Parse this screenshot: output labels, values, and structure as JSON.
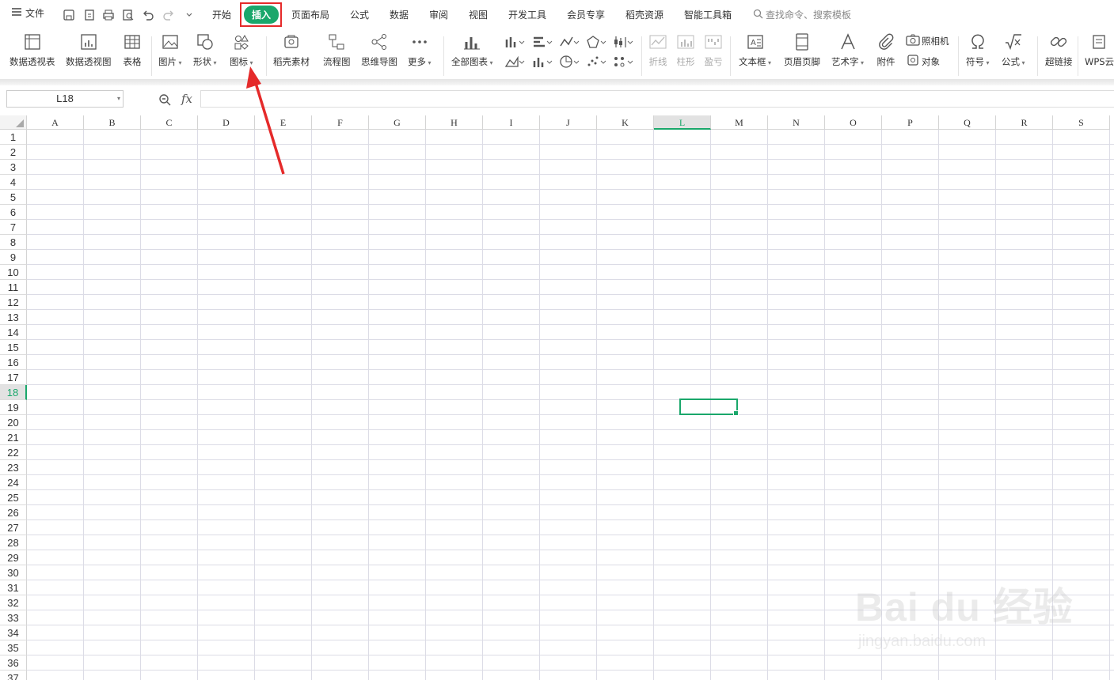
{
  "topbar": {
    "file_menu": "文件",
    "tabs": [
      "开始",
      "插入",
      "页面布局",
      "公式",
      "数据",
      "审阅",
      "视图",
      "开发工具",
      "会员专享",
      "稻壳资源",
      "智能工具箱"
    ],
    "search_placeholder": "查找命令、搜索模板",
    "accent": "#1aa76b"
  },
  "ribbon": {
    "groups": [
      [
        "数据透视表",
        "数据透视图",
        "表格"
      ],
      [
        "图片",
        "形状",
        "图标",
        "稻壳素材",
        "流程图",
        "思维导图",
        "更多"
      ],
      [
        "全部图表"
      ],
      [
        "折线",
        "柱形",
        "盈亏"
      ],
      [
        "文本框",
        "页眉页脚",
        "艺术字",
        "附件",
        "照相机",
        "对象"
      ],
      [
        "符号",
        "公式"
      ],
      [
        "超链接",
        "WPS云"
      ]
    ]
  },
  "formula_bar": {
    "name_box": "L18",
    "fx": "fx",
    "value": ""
  },
  "grid": {
    "columns": [
      "A",
      "B",
      "C",
      "D",
      "E",
      "F",
      "G",
      "H",
      "I",
      "J",
      "K",
      "L",
      "M",
      "N",
      "O",
      "P",
      "Q",
      "R",
      "S"
    ],
    "rows": [
      "1",
      "2",
      "3",
      "4",
      "5",
      "6",
      "7",
      "8",
      "9",
      "10",
      "11",
      "12",
      "13",
      "14",
      "15",
      "16",
      "17",
      "18",
      "19",
      "20",
      "21",
      "22",
      "23",
      "24",
      "25",
      "26",
      "27",
      "28",
      "29",
      "30",
      "31",
      "32",
      "33",
      "34",
      "35",
      "36",
      "37"
    ],
    "selected_column": "L",
    "selected_row": "18"
  },
  "watermark": {
    "brand": "Bai du 经验",
    "url": "jingyan.baidu.com"
  }
}
